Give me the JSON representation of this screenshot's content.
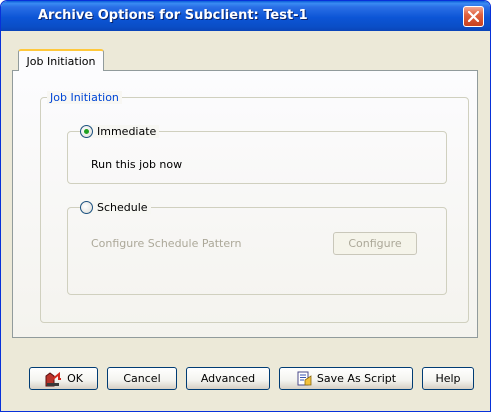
{
  "window": {
    "title": "Archive Options for Subclient: Test-1"
  },
  "tabs": [
    {
      "label": "Job Initiation",
      "active": true
    }
  ],
  "job_initiation": {
    "group_label": "Job Initiation",
    "immediate": {
      "label": "Immediate",
      "selected": true,
      "description": "Run this job now"
    },
    "schedule": {
      "label": "Schedule",
      "selected": false,
      "pattern_label": "Configure Schedule Pattern",
      "configure_button": "Configure"
    }
  },
  "buttons": {
    "ok": "OK",
    "cancel": "Cancel",
    "advanced": "Advanced",
    "save_as_script": "Save As Script",
    "help": "Help"
  },
  "icons": {
    "close": "close-icon",
    "ok": "ok-icon",
    "save_script": "script-icon"
  }
}
